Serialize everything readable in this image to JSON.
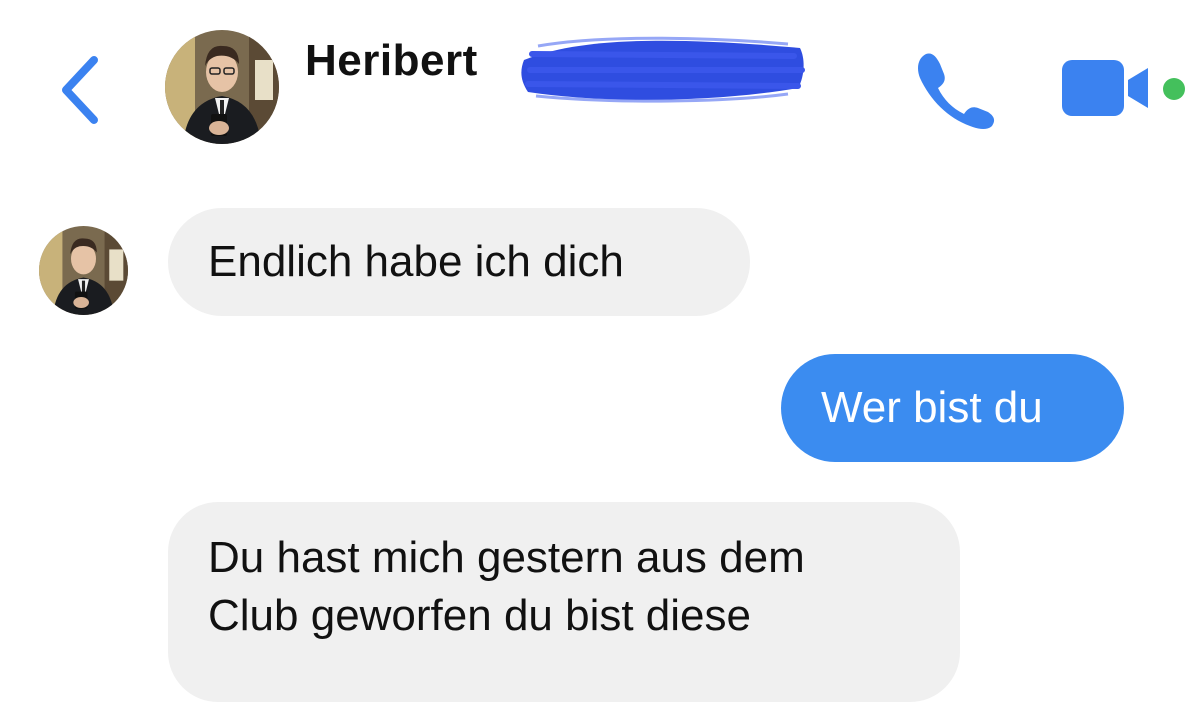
{
  "header": {
    "contact_name": "Heribert",
    "back_icon": "chevron-left-icon",
    "call_icon": "phone-icon",
    "video_icon": "video-camera-icon",
    "online_status": "online",
    "accent_color": "#3b82f0",
    "online_color": "#44c05c"
  },
  "messages": [
    {
      "direction": "incoming",
      "text": "Endlich habe ich dich"
    },
    {
      "direction": "outgoing",
      "text": "Wer bist du"
    },
    {
      "direction": "incoming",
      "lines": [
        "Du hast mich gestern aus dem",
        "Club geworfen du bist diese"
      ]
    }
  ],
  "colors": {
    "incoming_bubble": "#f0f0f0",
    "outgoing_bubble": "#3b8cf0",
    "background": "#ffffff"
  }
}
